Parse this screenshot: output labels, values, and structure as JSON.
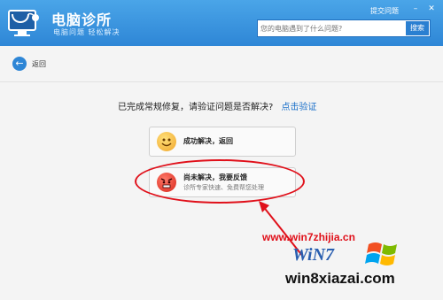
{
  "app": {
    "title": "电脑诊所",
    "slogan": "电脑问题 轻松解决"
  },
  "header": {
    "feedback": "提交问题",
    "search_placeholder": "您的电脑遇到了什么问题?",
    "search_button": "搜索"
  },
  "window_controls": {
    "minimize": "–",
    "close": "✕"
  },
  "nav": {
    "back": "返回"
  },
  "main": {
    "prompt": "已完成常规修复，请验证问题是否解决?",
    "verify_link": "点击验证",
    "option1": {
      "title": "成功解决，返回"
    },
    "option2": {
      "title": "尚未解决，我要反馈",
      "subtitle": "诊所专家快速、免费帮您处理"
    }
  },
  "watermark": {
    "site1": "www.win7zhijia.cn",
    "logo_text": "WiN7",
    "site2": "win8xiazai.com"
  },
  "colors": {
    "header": "#2e86d6",
    "link": "#1a6fc9",
    "highlight": "#e0101a"
  },
  "icons": {
    "logo": "stethoscope-monitor-icon",
    "back": "arrow-left-icon",
    "happy": "smiley-icon",
    "angry": "angry-face-icon",
    "windows": "windows-flag-icon"
  }
}
